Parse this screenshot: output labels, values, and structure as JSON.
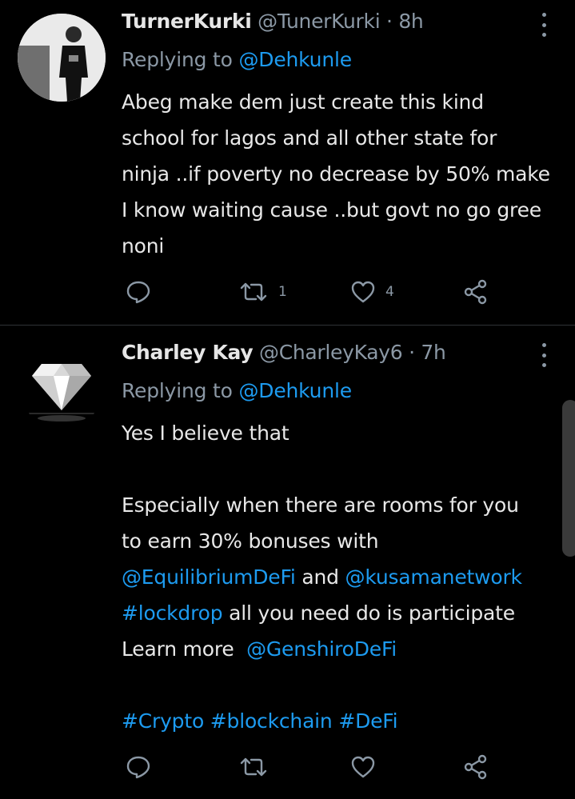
{
  "tweets": [
    {
      "name": "TurnerKurki",
      "handle": "@TunerKurki",
      "separator": "·",
      "time": "8h",
      "replying_prefix": "Replying to",
      "replying_to": "@Dehkunle",
      "lines": [
        "Abeg make dem just create this kind",
        "school for lagos and all other state for",
        "ninja ..if poverty no decrease by 50% make",
        "I know waiting cause ..but govt no go gree",
        "noni"
      ],
      "retweet_count": "1",
      "like_count": "4",
      "avatar_icon": "person-photo"
    },
    {
      "name": "Charley Kay",
      "handle": "@CharleyKay6",
      "separator": "·",
      "time": "7h",
      "replying_prefix": "Replying to",
      "replying_to": "@Dehkunle",
      "line1": "Yes I believe that",
      "line2": "Especially when  there are rooms for you",
      "line3": "to earn 30% bonuses with",
      "line4_link1": "@EquilibriumDeFi",
      "line4_mid": " and ",
      "line4_link2": "@kusamanetwork",
      "line5_tag": "#lockdrop",
      "line5_rest": " all you need do is participate",
      "line6_text": "Learn more  ",
      "line6_link": "@GenshiroDeFi",
      "hashtags": [
        "#Crypto",
        "#blockchain",
        "#DeFi"
      ],
      "retweet_count": "",
      "like_count": "",
      "avatar_icon": "diamond-logo"
    }
  ],
  "colors": {
    "link": "#1d9bf0",
    "muted": "#8b98a5",
    "background": "#000000"
  }
}
